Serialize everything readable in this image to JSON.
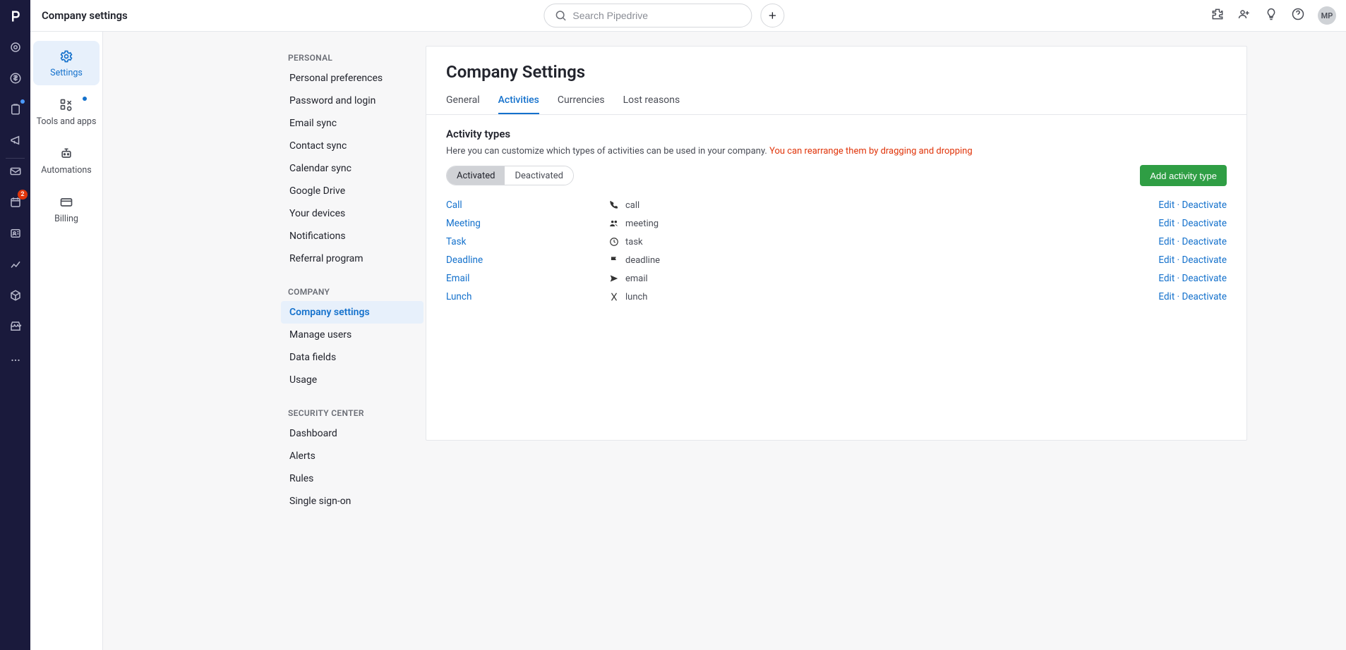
{
  "header": {
    "title": "Company settings",
    "search_placeholder": "Search Pipedrive",
    "avatar_initials": "MP"
  },
  "leftnav": {
    "badge_count": "2"
  },
  "sidebar2": {
    "items": [
      {
        "label": "Settings"
      },
      {
        "label": "Tools and apps"
      },
      {
        "label": "Automations"
      },
      {
        "label": "Billing"
      }
    ]
  },
  "settingsnav": {
    "groups": [
      {
        "label": "PERSONAL",
        "items": [
          {
            "label": "Personal preferences"
          },
          {
            "label": "Password and login"
          },
          {
            "label": "Email sync"
          },
          {
            "label": "Contact sync"
          },
          {
            "label": "Calendar sync"
          },
          {
            "label": "Google Drive"
          },
          {
            "label": "Your devices"
          },
          {
            "label": "Notifications"
          },
          {
            "label": "Referral program"
          }
        ]
      },
      {
        "label": "COMPANY",
        "items": [
          {
            "label": "Company settings"
          },
          {
            "label": "Manage users"
          },
          {
            "label": "Data fields"
          },
          {
            "label": "Usage"
          }
        ]
      },
      {
        "label": "SECURITY CENTER",
        "items": [
          {
            "label": "Dashboard"
          },
          {
            "label": "Alerts"
          },
          {
            "label": "Rules"
          },
          {
            "label": "Single sign-on"
          }
        ]
      }
    ]
  },
  "main": {
    "title": "Company Settings",
    "tabs": [
      {
        "label": "General"
      },
      {
        "label": "Activities"
      },
      {
        "label": "Currencies"
      },
      {
        "label": "Lost reasons"
      }
    ],
    "section_title": "Activity types",
    "section_sub_a": "Here you can customize which types of activities can be used in your company. ",
    "section_sub_b": "You can rearrange them by dragging and dropping",
    "pill_activated": "Activated",
    "pill_deactivated": "Deactivated",
    "add_btn": "Add activity type",
    "edit_label": "Edit",
    "deactivate_label": "Deactivate",
    "sep": " · ",
    "rows": [
      {
        "name": "Call",
        "key": "call",
        "icon": "phone"
      },
      {
        "name": "Meeting",
        "key": "meeting",
        "icon": "people"
      },
      {
        "name": "Task",
        "key": "task",
        "icon": "clock"
      },
      {
        "name": "Deadline",
        "key": "deadline",
        "icon": "flag"
      },
      {
        "name": "Email",
        "key": "email",
        "icon": "send"
      },
      {
        "name": "Lunch",
        "key": "lunch",
        "icon": "utensils"
      }
    ]
  }
}
